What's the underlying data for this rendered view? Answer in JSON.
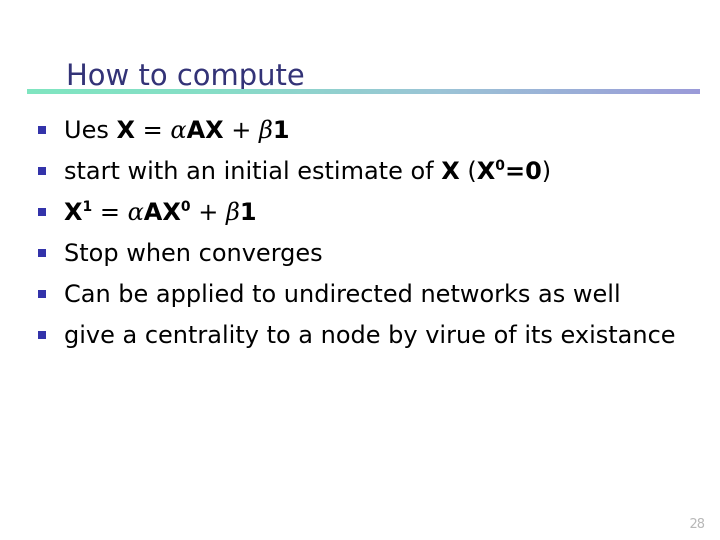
{
  "slide": {
    "title": "How to compute",
    "page_number": "28",
    "title_color": "#333377",
    "bullet_color": "#3333aa",
    "rule_gradient_start": "#7fe5c0",
    "rule_gradient_end": "#9a9ad8",
    "body_text_color": "#000000",
    "background_color": "#ffffff"
  },
  "bullets": [
    {
      "id": "bullet-equation-definition",
      "plain": "Ues X = αAX + β1",
      "parts": [
        {
          "text": "Ues ",
          "style": "normal"
        },
        {
          "text": "X",
          "style": "bold"
        },
        {
          "text": " = ",
          "style": "normal"
        },
        {
          "text": "α",
          "style": "greek"
        },
        {
          "text": "AX",
          "style": "bold"
        },
        {
          "text": " + ",
          "style": "normal"
        },
        {
          "text": "β",
          "style": "greek"
        },
        {
          "text": "1",
          "style": "bold"
        }
      ]
    },
    {
      "id": "bullet-initial-estimate",
      "plain": "start with an initial estimate of X (X0=0)",
      "parts": [
        {
          "text": "start with an initial estimate of ",
          "style": "normal"
        },
        {
          "text": "X",
          "style": "bold"
        },
        {
          "text": " (",
          "style": "normal"
        },
        {
          "text": "X",
          "style": "bold"
        },
        {
          "text": "0",
          "style": "bold-sup"
        },
        {
          "text": "=0",
          "style": "bold"
        },
        {
          "text": ")",
          "style": "normal"
        }
      ]
    },
    {
      "id": "bullet-iteration-step",
      "plain": "X1 = αAX0 + β1",
      "parts": [
        {
          "text": "X",
          "style": "bold"
        },
        {
          "text": "1",
          "style": "bold-sup"
        },
        {
          "text": " = ",
          "style": "normal"
        },
        {
          "text": "α",
          "style": "greek"
        },
        {
          "text": "AX",
          "style": "bold"
        },
        {
          "text": "0",
          "style": "bold-sup"
        },
        {
          "text": " + ",
          "style": "normal"
        },
        {
          "text": "β",
          "style": "greek"
        },
        {
          "text": "1",
          "style": "bold"
        }
      ]
    },
    {
      "id": "bullet-stop-condition",
      "plain": "Stop when converges",
      "parts": [
        {
          "text": "Stop when converges",
          "style": "normal"
        }
      ]
    },
    {
      "id": "bullet-undirected-networks",
      "plain": "Can be applied to undirected networks as well",
      "parts": [
        {
          "text": "Can be applied to undirected networks as well",
          "style": "normal"
        }
      ]
    },
    {
      "id": "bullet-centrality-virtue",
      "plain": "give a centrality to a node by virue of its existance",
      "parts": [
        {
          "text": "give a centrality to a node by virue of its existance",
          "style": "normal"
        }
      ]
    }
  ]
}
